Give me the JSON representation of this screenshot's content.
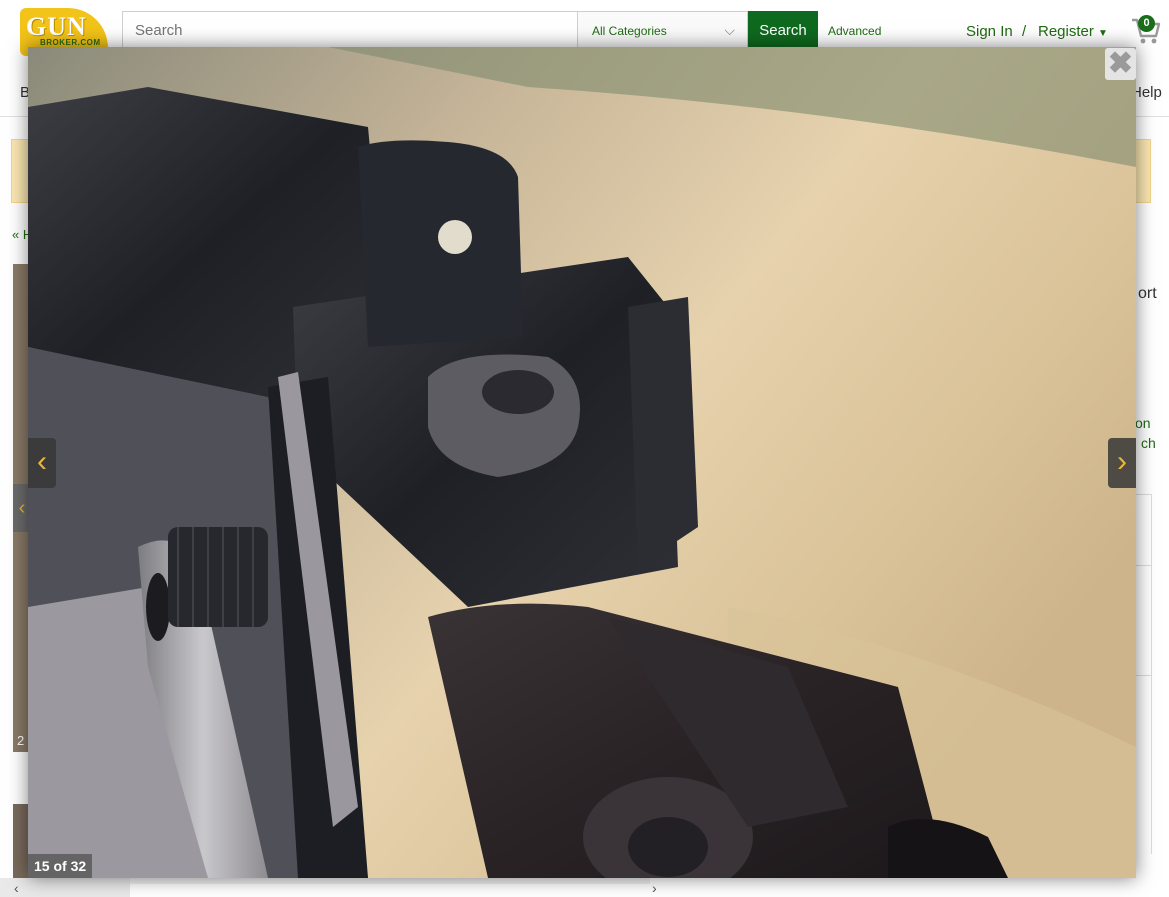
{
  "header": {
    "logo_text_main": "GUN",
    "logo_text_sub": "BROKER.COM",
    "search_placeholder": "Search",
    "category_selected": "All Categories",
    "search_button": "Search",
    "advanced_link": "Advanced",
    "sign_in": "Sign In",
    "slash": "/",
    "register": "Register",
    "cart_count": "0"
  },
  "nav": {
    "left_fragment": "B",
    "help": "Help"
  },
  "page": {
    "back_link": "« H",
    "thumb_count_fragment": "2",
    "right_title_fragment": "ort",
    "right_link_fragment1": "on",
    "right_link_fragment2": "ch"
  },
  "lightbox": {
    "counter": "15 of 32",
    "close_glyph": "✖",
    "prev_glyph": "‹",
    "next_glyph": "›"
  },
  "colors": {
    "brand_green": "#0e6a1f",
    "logo_yellow": "#f2c318",
    "nav_accent": "#e8b63a"
  }
}
